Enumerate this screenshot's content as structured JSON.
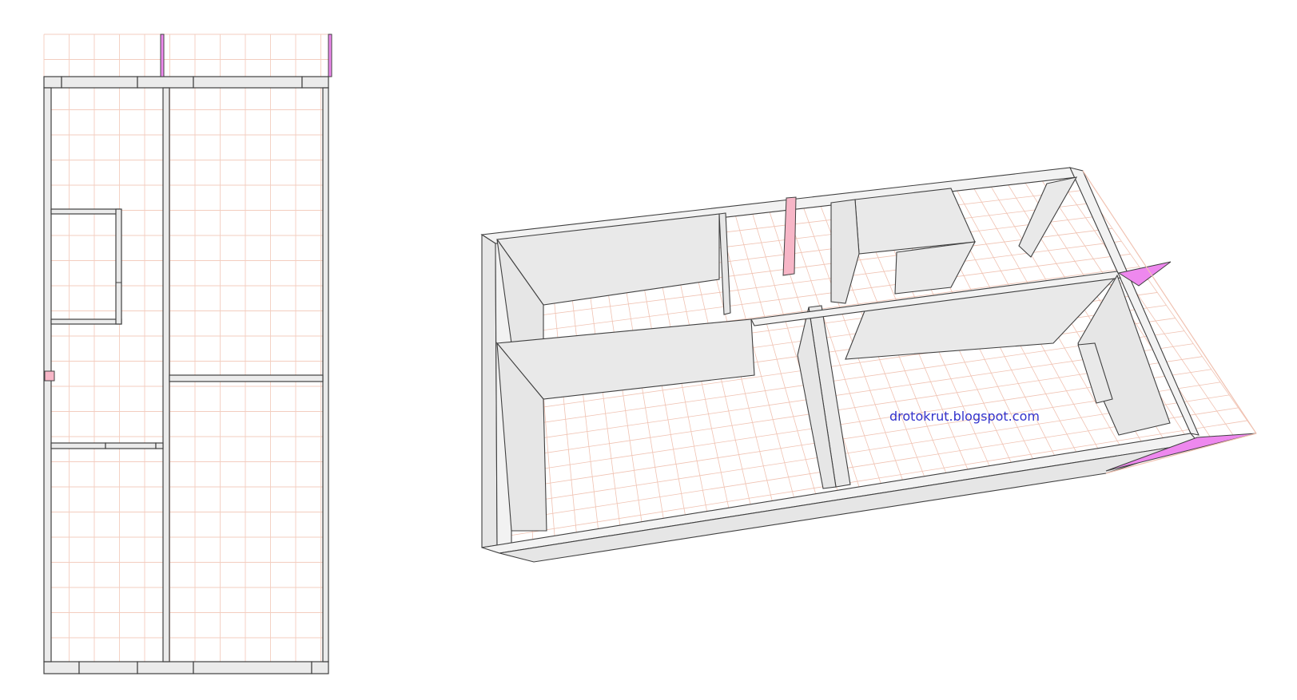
{
  "watermark": "drotokrut.blogspot.com",
  "colors": {
    "background": "#ffffff",
    "wall_fill": "#ebebeb",
    "wall_stroke": "#404040",
    "floor_grid": "#f3cdbf",
    "post_pink": "#f7b6c7",
    "beam_magenta": "#ee88ee",
    "watermark": "#3333cc"
  },
  "views": [
    "plan-view",
    "perspective-view"
  ]
}
